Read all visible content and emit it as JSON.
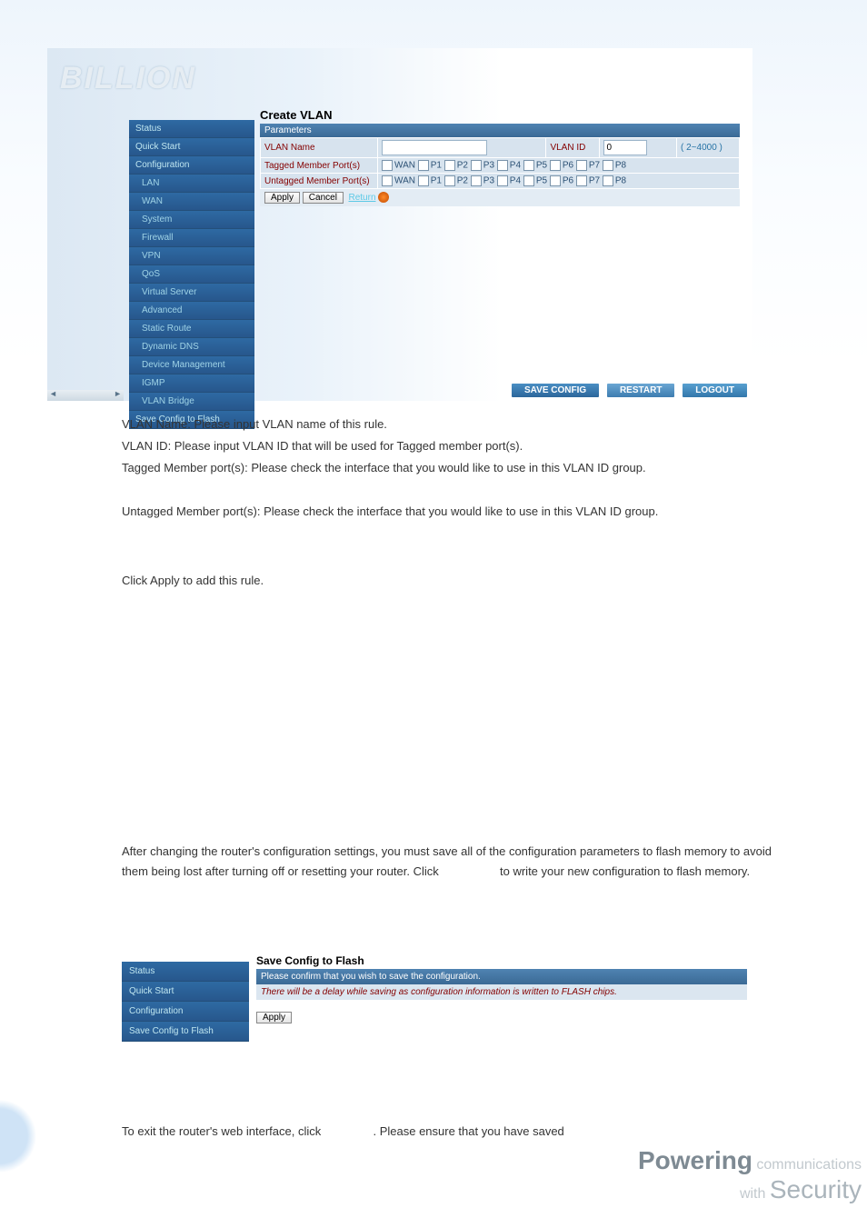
{
  "shot1": {
    "brand": "BILLION",
    "sidebar": [
      {
        "label": "Status",
        "sub": false
      },
      {
        "label": "Quick Start",
        "sub": false
      },
      {
        "label": "Configuration",
        "sub": false
      },
      {
        "label": "LAN",
        "sub": true
      },
      {
        "label": "WAN",
        "sub": true
      },
      {
        "label": "System",
        "sub": true
      },
      {
        "label": "Firewall",
        "sub": true
      },
      {
        "label": "VPN",
        "sub": true
      },
      {
        "label": "QoS",
        "sub": true
      },
      {
        "label": "Virtual Server",
        "sub": true
      },
      {
        "label": "Advanced",
        "sub": true
      },
      {
        "label": "Static Route",
        "sub": true
      },
      {
        "label": "Dynamic DNS",
        "sub": true
      },
      {
        "label": "Device Management",
        "sub": true
      },
      {
        "label": "IGMP",
        "sub": true
      },
      {
        "label": "VLAN Bridge",
        "sub": true
      },
      {
        "label": "Save Config to Flash",
        "sub": false
      }
    ],
    "panel_title": "Create VLAN",
    "params_label": "Parameters",
    "row_vlan_name": "VLAN Name",
    "row_vlan_id": "VLAN ID",
    "vlan_id_value": "0",
    "vlan_id_range": "( 2~4000 )",
    "row_tagged": "Tagged Member Port(s)",
    "row_untagged": "Untagged Member Port(s)",
    "ports": {
      "wan": "WAN",
      "p1": "P1",
      "p2": "P2",
      "p3": "P3",
      "p4": "P4",
      "p5": "P5",
      "p6": "P6",
      "p7": "P7",
      "p8": "P8"
    },
    "btn_apply": "Apply",
    "btn_cancel": "Cancel",
    "link_return": "Return",
    "footer": {
      "save": "SAVE CONFIG",
      "restart": "RESTART",
      "logout": "LOGOUT"
    }
  },
  "doc": {
    "p1": "VLAN Name: Please input VLAN name of this rule.",
    "p2": "VLAN ID: Please input VLAN ID that will be used for Tagged member port(s).",
    "p3": "Tagged Member port(s): Please check the interface that you would like to use in this VLAN ID group.",
    "p4": "Untagged Member port(s): Please check the interface that you would like to use in this VLAN ID group.",
    "p5": "Click Apply to add this rule.",
    "p6a": "After changing the router's configuration settings, you must save all of the configuration parameters to flash memory to avoid them being lost after turning off or resetting your router. Click ",
    "p6b": " to write your new configuration to flash memory.",
    "p7a": "To exit the router's web interface, click ",
    "p7b": ". Please ensure that you have saved"
  },
  "shot2": {
    "sidebar": [
      {
        "label": "Status"
      },
      {
        "label": "Quick Start"
      },
      {
        "label": "Configuration"
      },
      {
        "label": "Save Config to Flash"
      }
    ],
    "title": "Save Config to Flash",
    "confirm": "Please confirm that you wish to save the configuration.",
    "delay": "There will be a delay while saving as configuration information is written to FLASH chips.",
    "btn": "Apply"
  },
  "tagline": {
    "powering": "Powering",
    "comm": " communications",
    "with": "with ",
    "sec": "Security"
  }
}
